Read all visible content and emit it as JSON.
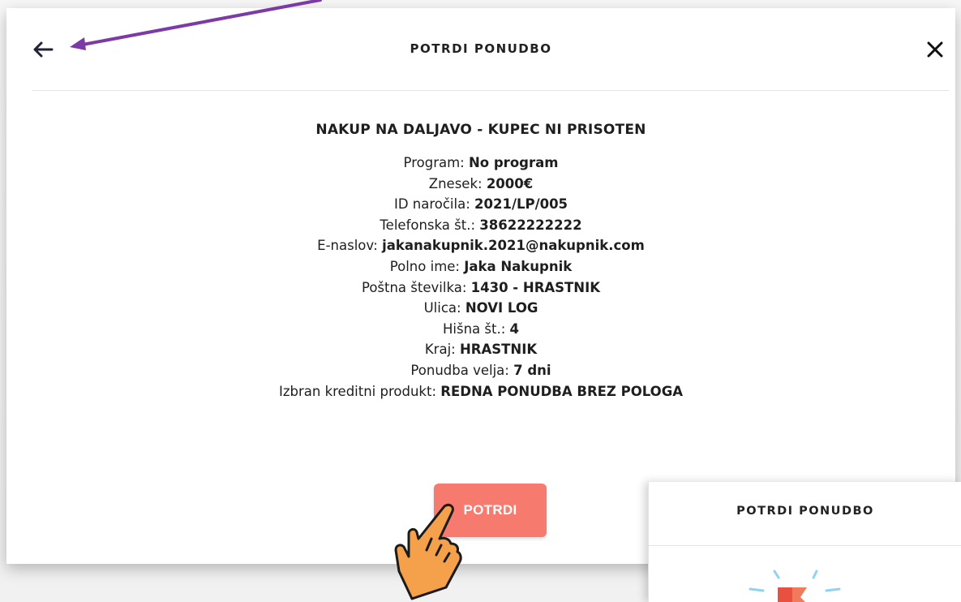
{
  "modal": {
    "title": "POTRDI PONUDBO",
    "subtitle": "NAKUP NA DALJAVO - KUPEC NI PRISOTEN",
    "rows": [
      {
        "label": "Program:",
        "value": "No program"
      },
      {
        "label": "Znesek:",
        "value": "2000€"
      },
      {
        "label": "ID naročila:",
        "value": "2021/LP/005"
      },
      {
        "label": "Telefonska št.:",
        "value": "38622222222"
      },
      {
        "label": "E-naslov:",
        "value": "jakanakupnik.2021@nakupnik.com"
      },
      {
        "label": "Polno ime:",
        "value": "Jaka Nakupnik"
      },
      {
        "label": "Poštna številka:",
        "value": "1430 - HRASTNIK"
      },
      {
        "label": "Ulica:",
        "value": "NOVI LOG"
      },
      {
        "label": "Hišna št.:",
        "value": "4"
      },
      {
        "label": "Kraj:",
        "value": "HRASTNIK"
      },
      {
        "label": "Ponudba velja:",
        "value": "7 dni"
      },
      {
        "label": "Izbran kreditni produkt:",
        "value": "REDNA PONUDBA BREZ POLOGA"
      }
    ],
    "confirm_label": "POTRDI",
    "icons": {
      "back": "back-arrow-icon",
      "close": "close-icon"
    }
  },
  "preview_panel": {
    "title": "POTRDI PONUDBO"
  },
  "colors": {
    "confirm_button": "#f77a6e",
    "annotation_arrow": "#7b3aa6",
    "pointer_hand": "#f5a04a"
  }
}
